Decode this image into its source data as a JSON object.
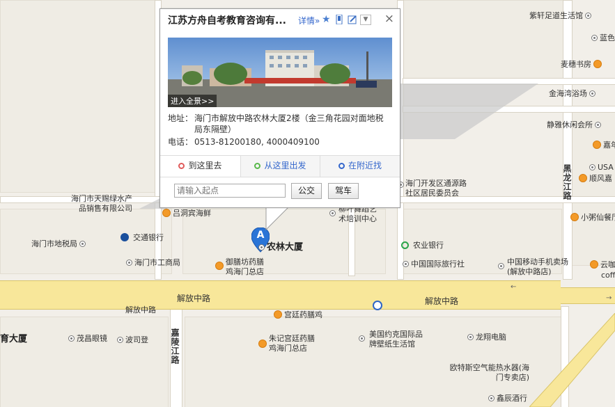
{
  "popup": {
    "title": "江苏方舟自考教育咨询有...",
    "detail_link": "详情»",
    "close_symbol": "×",
    "photo_caption": "进入全景>>",
    "address_label": "地址：",
    "address_value": "海门市解放中路农林大厦2楼（金三角花园对面地税局东隔壁）",
    "phone_label": "电话：",
    "phone_value": "0513-81200180, 4000409100",
    "tabs": [
      {
        "label": "到这里去",
        "icon_color": "#e05a5a"
      },
      {
        "label": "从这里出发",
        "icon_color": "#58b84a"
      },
      {
        "label": "在附近找",
        "icon_color": "#3366cc"
      }
    ],
    "start_placeholder": "请输入起点",
    "bus_button": "公交",
    "drive_button": "驾车"
  },
  "marker": {
    "letter": "A",
    "label": "农林大厦"
  },
  "roads": {
    "jiefang_zhonglu_1": "解放中路",
    "jiefang_zhonglu_2": "解放中路",
    "jiefang_zhonglu_3": "解放中路",
    "jialingjiang_lu": "嘉陵江路",
    "heilongjiang_lu": "黑龙江路"
  },
  "pois": {
    "zixuan": "紫轩足道生活馆",
    "landi": "蓝色",
    "maisui": "麦穗书房",
    "jinhaiwan": "金海湾浴场",
    "jingyi": "静雅休闲会所",
    "jiaqian": "嘉年",
    "usa": "USA",
    "shunfeng": "顺风嘉",
    "xiaozhou": "小粥仙餐厅",
    "kaifaqu": "海门开发区通源路社区居民委员会",
    "tianci": "海门市天赐绿水产品销售有限公司",
    "lvdong": "吕洞宾海鲜",
    "liuye": "柳叶舞蹈艺术培训中心",
    "jiaotong": "交通银行",
    "nongye": "农业银行",
    "dishui": "海门市地税局",
    "gongshang": "海门市工商局",
    "yushanfang": "御膳坊药膳鸡海门总店",
    "guolv": "中国国际旅行社",
    "yidong": "中国移动手机卖场(解放中路店)",
    "yunka": "云咖",
    "coff": "coff",
    "gongting": "宫廷药膳鸡",
    "yujiao": "育大厦",
    "maochang": "茂昌眼镜",
    "bosi": "波司登",
    "zhuji": "朱记宫廷药膳鸡海门总店",
    "meiguo": "美国约克国际品牌壁纸生活馆",
    "longxiang": "龙翔电脑",
    "outesi": "欧特斯空气能热水器(海门专卖店)",
    "xinchen": "鑫辰酒行"
  },
  "icons": {
    "star": "star-icon",
    "phone": "phone-icon",
    "edit": "edit-icon",
    "dropdown": "chevron-down-icon",
    "bus_stop": "bus-stop-icon"
  }
}
